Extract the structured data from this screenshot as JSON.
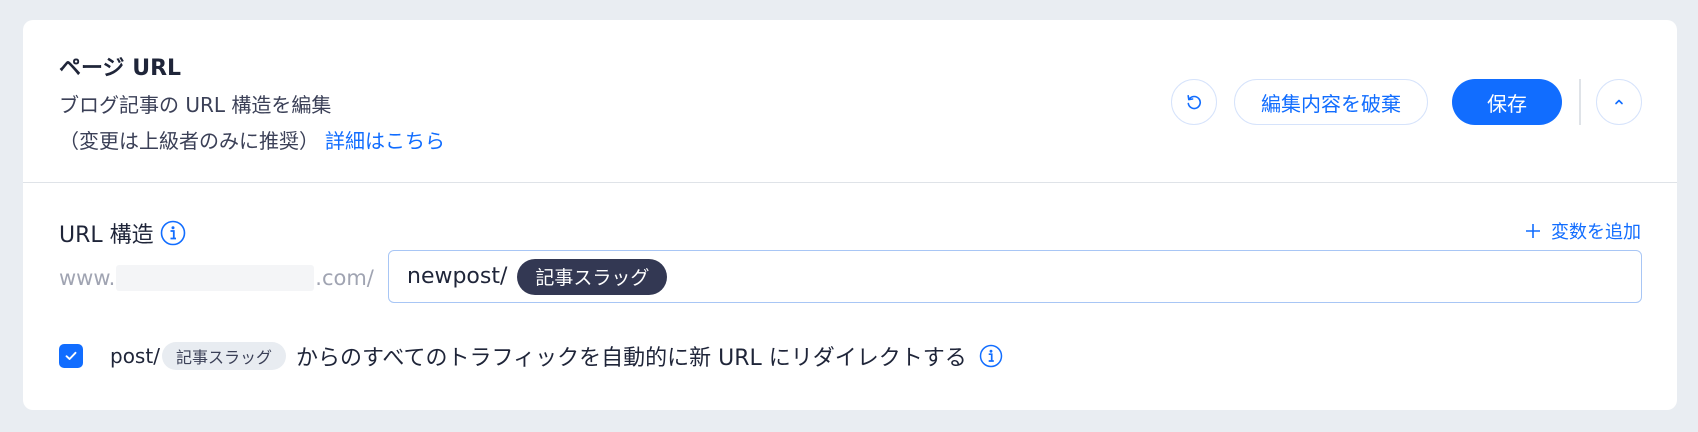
{
  "header": {
    "title": "ページ URL",
    "subtitle": "ブログ記事の URL 構造を編集",
    "note": "（変更は上級者のみに推奨）",
    "learn_more": "詳細はこちら"
  },
  "actions": {
    "discard_label": "編集内容を破棄",
    "save_label": "保存"
  },
  "url_structure": {
    "label": "URL 構造",
    "add_variable": "変数を追加",
    "prefix_start": "www.",
    "prefix_end": ".com/",
    "path_text": "newpost/",
    "slug_chip": "記事スラッグ"
  },
  "redirect": {
    "checked": true,
    "old_path": "post/",
    "old_slug_chip": "記事スラッグ",
    "text": "からのすべてのトラフィックを自動的に新 URL にリダイレクトする"
  },
  "colors": {
    "accent": "#116dff",
    "chip_dark": "#333853",
    "background": "#e9edf2"
  },
  "icons": [
    "reset-icon",
    "chevron-up-icon",
    "info-icon",
    "plus-icon",
    "checkmark-icon"
  ]
}
